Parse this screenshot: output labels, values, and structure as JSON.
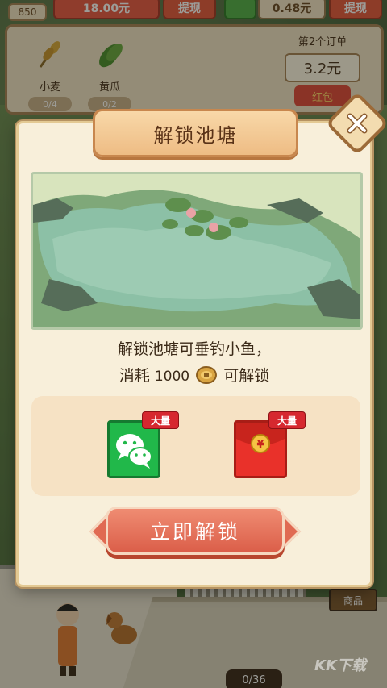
{
  "hud": {
    "coin_count": "850",
    "money_amount": "18.00元",
    "withdraw_label": "提现",
    "wechat_amount": "0.48元",
    "withdraw_label_2": "提现"
  },
  "crops": [
    {
      "name": "小麦",
      "progress": "0/4"
    },
    {
      "name": "黄瓜",
      "progress": "0/2"
    }
  ],
  "order": {
    "title": "第2个订单",
    "value": "3.2元",
    "reward_label": "红包"
  },
  "dialog": {
    "title": "解锁池塘",
    "desc_line1": "解锁池塘可垂钓小鱼，",
    "desc_prefix": "消耗",
    "cost": "1000",
    "desc_suffix": "可解锁",
    "rewards": [
      {
        "icon": "wechat-icon",
        "tag": "大量",
        "color": "#21b84a"
      },
      {
        "icon": "red-envelope-icon",
        "tag": "大量",
        "color": "#e9312a"
      }
    ],
    "unlock_button": "立即解锁"
  },
  "bottom_counter": "0/36",
  "sign_label": "商品",
  "watermark": "KK下载"
}
